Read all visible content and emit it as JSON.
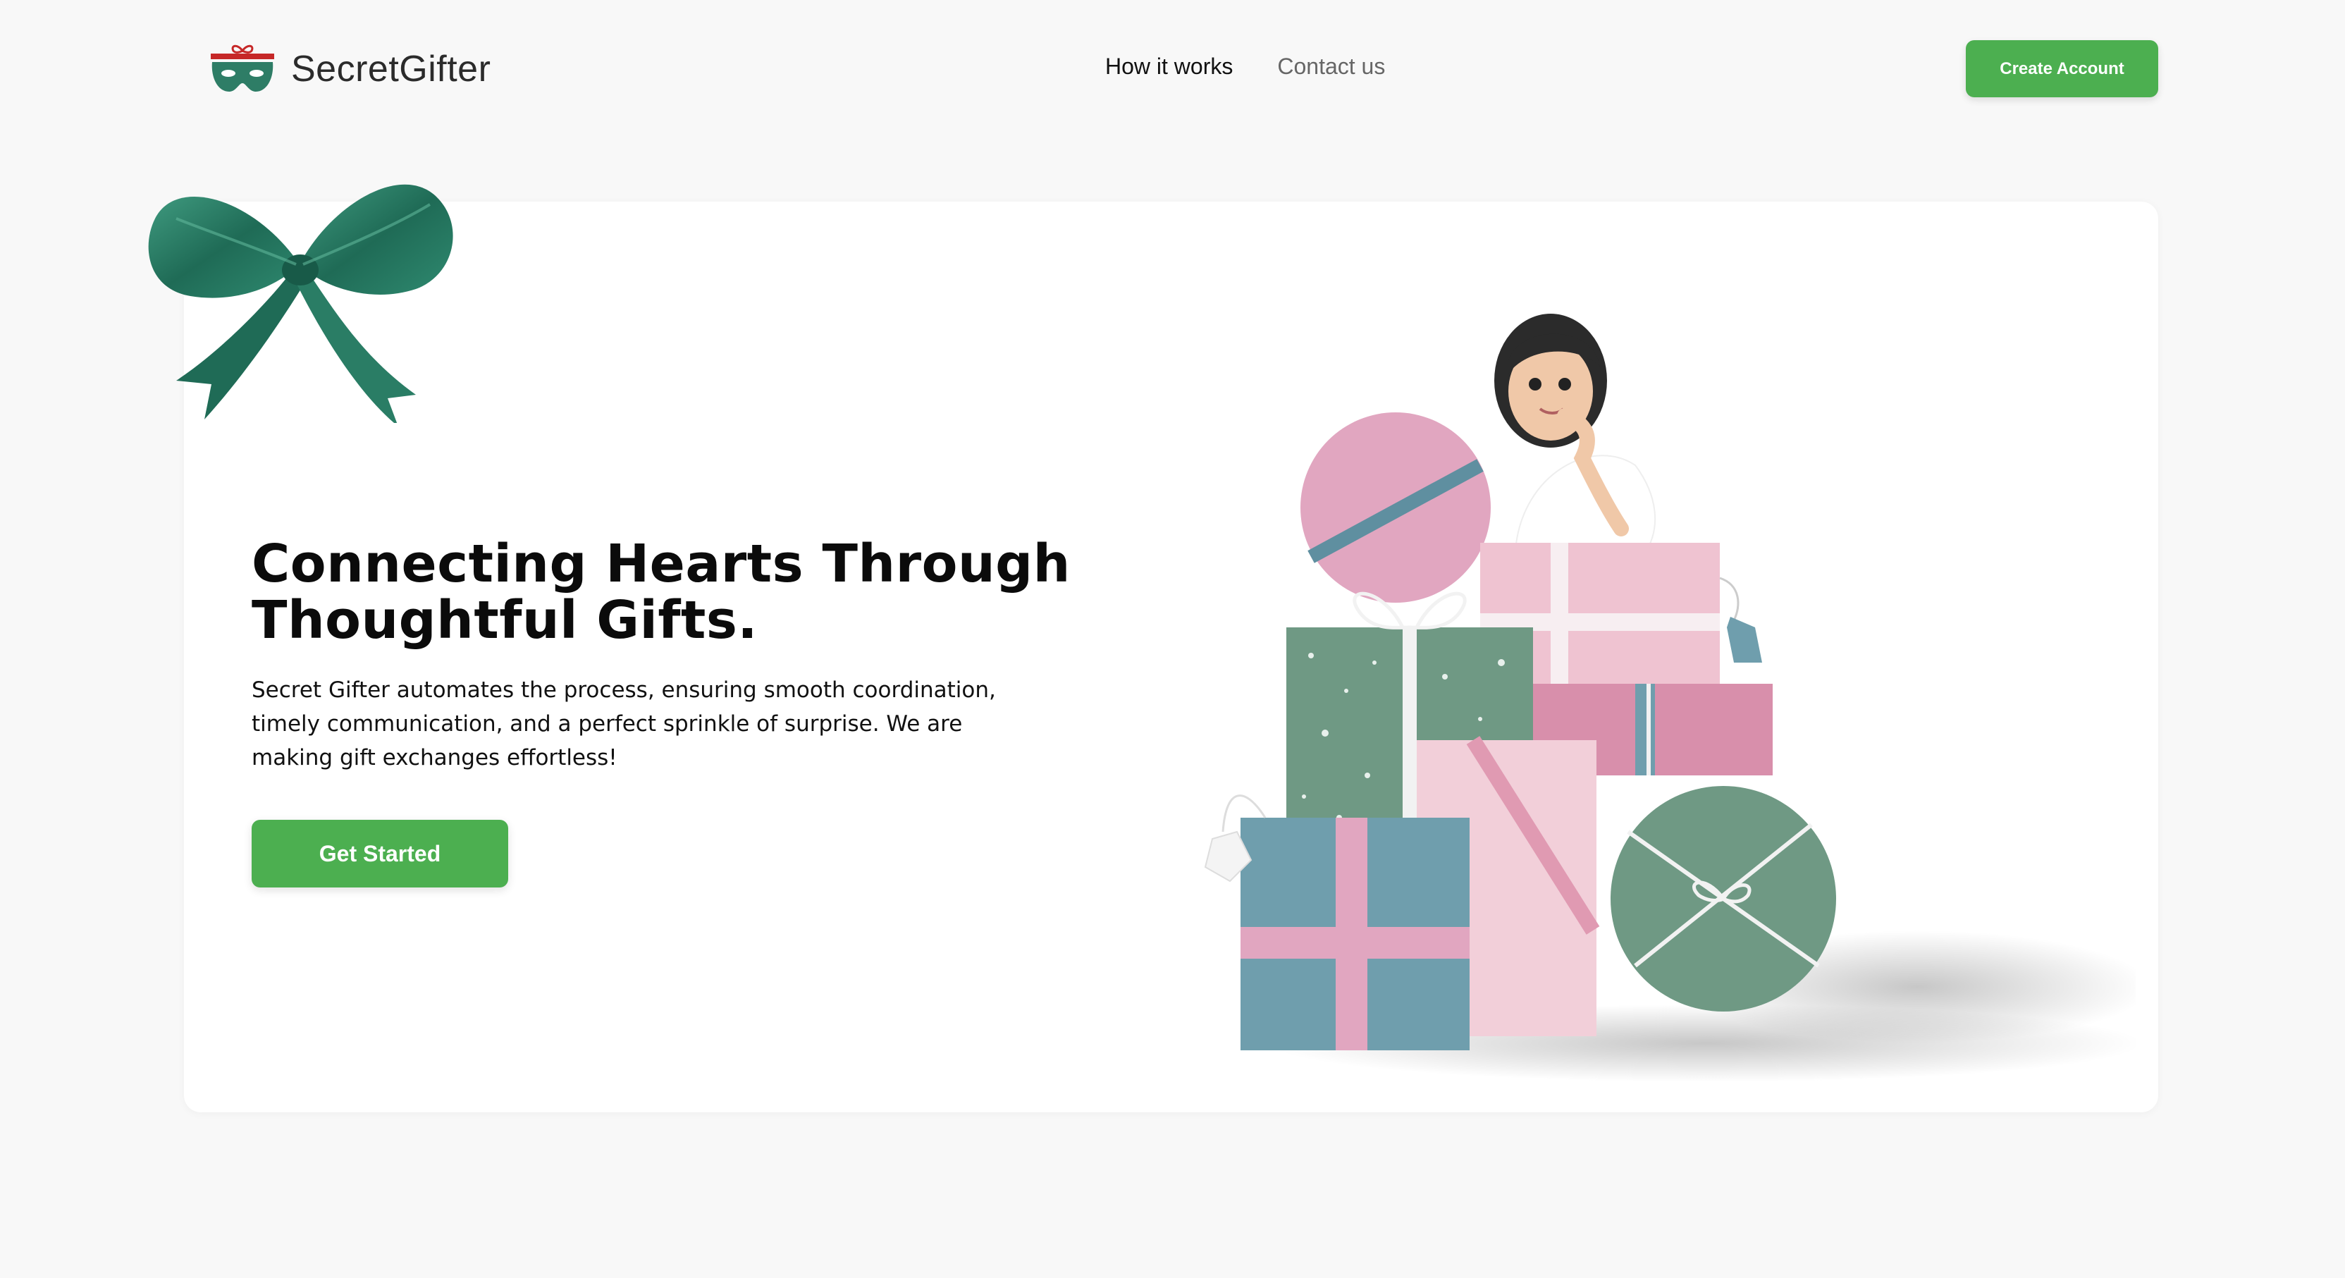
{
  "brand": {
    "name": "SecretGifter",
    "logo_icon": "gift-mask-icon"
  },
  "nav": {
    "items": [
      {
        "label": "How it works",
        "active": true
      },
      {
        "label": "Contact us",
        "active": false
      }
    ]
  },
  "header": {
    "cta_label": "Create Account"
  },
  "hero": {
    "title": "Connecting Hearts Through Thoughtful Gifts.",
    "description": "Secret Gifter automates the process, ensuring smooth coordination, timely communication, and a perfect sprinkle of surprise. We are making gift exchanges effortless!",
    "cta_label": "Get Started",
    "decoration_icon": "ribbon-bow-icon",
    "illustration": "woman-with-gift-boxes-illustration"
  },
  "colors": {
    "accent": "#4caf50",
    "background": "#f8f8f8",
    "card": "#ffffff",
    "bow": "#2e7d66",
    "pink": "#e1a6c0",
    "teal": "#6f9ead",
    "green_box": "#6f9984"
  }
}
